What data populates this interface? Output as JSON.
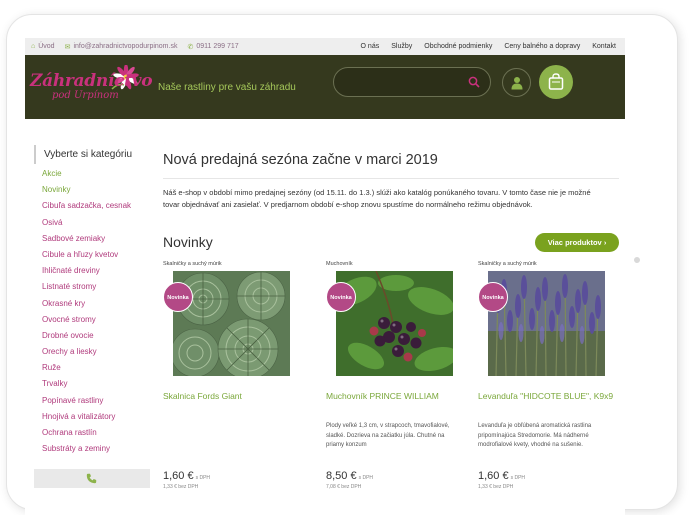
{
  "topbar": {
    "home": "Úvod",
    "email": "info@zahradnictvopodurpinom.sk",
    "phone": "0911 299 717",
    "links": [
      "O nás",
      "Služby",
      "Obchodné podmienky",
      "Ceny balného a dopravy",
      "Kontakt"
    ]
  },
  "header": {
    "logo_line1": "Záhradníctvo",
    "logo_line2": "pod Urpínom",
    "tagline": "Naše rastliny pre vašu záhradu",
    "search_placeholder": ""
  },
  "sidebar": {
    "title": "Vyberte si kategóriu",
    "items": [
      {
        "label": "Akcie",
        "color": "green"
      },
      {
        "label": "Novinky",
        "color": "green"
      },
      {
        "label": "Cibuľa sadzačka, cesnak",
        "color": "pink"
      },
      {
        "label": "Osivá",
        "color": "pink"
      },
      {
        "label": "Sadbové zemiaky",
        "color": "pink"
      },
      {
        "label": "Cibule a hľuzy kvetov",
        "color": "pink"
      },
      {
        "label": "Ihličnaté dreviny",
        "color": "pink"
      },
      {
        "label": "Listnaté stromy",
        "color": "pink"
      },
      {
        "label": "Okrasné kry",
        "color": "pink"
      },
      {
        "label": "Ovocné stromy",
        "color": "pink"
      },
      {
        "label": "Drobné ovocie",
        "color": "pink"
      },
      {
        "label": "Orechy a liesky",
        "color": "pink"
      },
      {
        "label": "Ruže",
        "color": "pink"
      },
      {
        "label": "Trvalky",
        "color": "pink"
      },
      {
        "label": "Popínavé rastliny",
        "color": "pink"
      },
      {
        "label": "Hnojivá a vitalizátory",
        "color": "pink"
      },
      {
        "label": "Ochrana rastlín",
        "color": "pink"
      },
      {
        "label": "Substráty a zeminy",
        "color": "pink"
      }
    ]
  },
  "main": {
    "headline": "Nová predajná sezóna začne v marci 2019",
    "intro": "Náš e-shop v období mimo predajnej sezóny (od 15.11. do 1.3.) slúži ako katalóg ponúkaného tovaru. V tomto čase nie je možné tovar objednávať ani zasielať. V predjarnom období e-shop znovu spustíme do normálneho režimu objednávok.",
    "section_title": "Novinky",
    "more_button": "Viac produktov ›"
  },
  "products": [
    {
      "category": "Skalničky a suchý múrik",
      "badge": "Novinka",
      "name": "Skalnica Fords Giant",
      "description": "",
      "price": "1,60 €",
      "price_vat": "s DPH",
      "price_net": "1,33 € bez DPH"
    },
    {
      "category": "Muchovník",
      "badge": "Novinka",
      "name": "Muchovník PRINCE WILLIAM",
      "description": "Plody veľké 1,3 cm, v strapcoch, tmavofialové, sladké. Dozrieva na začiatku júla. Chutné na priamy konzum",
      "price": "8,50 €",
      "price_vat": "s DPH",
      "price_net": "7,08 € bez DPH"
    },
    {
      "category": "Skalničky a suchý múrik",
      "badge": "Novinka",
      "name": "Levanduľa \"HIDCOTE BLUE\", K9x9",
      "description": "Levanduľa je obľúbená aromatická rastlina pripomínajúca Stredomorie. Má nádherné modrofialové kvety, vhodné na sušenie.",
      "price": "1,60 €",
      "price_vat": "s DPH",
      "price_net": "1,33 € bez DPH"
    }
  ],
  "colors": {
    "header_bg": "#35391e",
    "accent_green": "#8db34b",
    "accent_pink": "#b03a7c",
    "badge": "#b34986"
  }
}
